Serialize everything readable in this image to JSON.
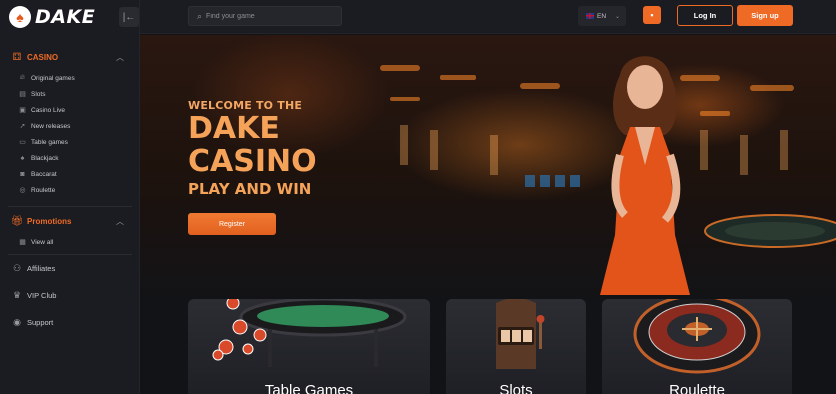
{
  "brand": {
    "name": "DAKE",
    "logo_icon": "spade-icon"
  },
  "sidebar": {
    "casino": {
      "label": "CASINO",
      "items": [
        {
          "label": "Original games",
          "icon": "fire-icon"
        },
        {
          "label": "Slots",
          "icon": "slots-icon"
        },
        {
          "label": "Casino Live",
          "icon": "live-icon"
        },
        {
          "label": "New releases",
          "icon": "rocket-icon"
        },
        {
          "label": "Table games",
          "icon": "cards-icon"
        },
        {
          "label": "Blackjack",
          "icon": "spade-icon"
        },
        {
          "label": "Baccarat",
          "icon": "chip-icon"
        },
        {
          "label": "Roulette",
          "icon": "roulette-icon"
        }
      ]
    },
    "promotions": {
      "label": "Promotions",
      "items": [
        {
          "label": "View all",
          "icon": "grid-icon"
        }
      ]
    },
    "links": [
      {
        "label": "Affiliates",
        "icon": "affiliates-icon"
      },
      {
        "label": "VIP Club",
        "icon": "crown-icon"
      },
      {
        "label": "Support",
        "icon": "support-icon"
      }
    ]
  },
  "header": {
    "search_placeholder": "Find your game",
    "language": "EN",
    "login_label": "Log In",
    "signup_label": "Sign up"
  },
  "hero": {
    "welcome": "WELCOME TO THE",
    "title_line1": "DAKE",
    "title_line2": "CASINO",
    "subtitle": "PLAY AND WIN",
    "cta_label": "Register"
  },
  "categories": [
    {
      "title": "Table Games"
    },
    {
      "title": "Slots"
    },
    {
      "title": "Roulette"
    }
  ],
  "colors": {
    "accent": "#ef6a25",
    "background": "#121317",
    "sidebar": "#1b1c21"
  }
}
